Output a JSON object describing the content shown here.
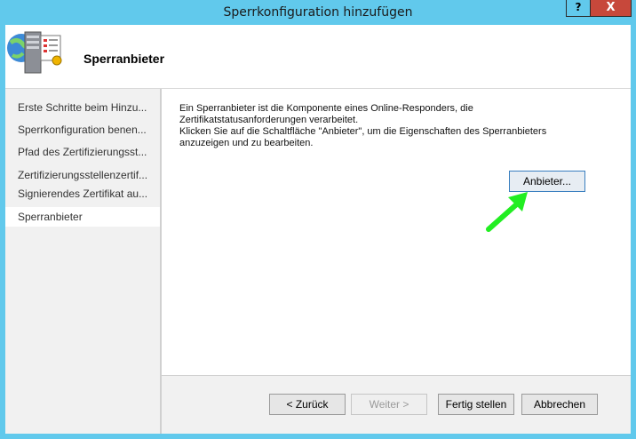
{
  "window": {
    "title": "Sperrkonfiguration hinzufügen",
    "help_label": "?",
    "close_label": "X"
  },
  "header": {
    "title": "Sperranbieter",
    "icon": "server-certificate-icon"
  },
  "sidebar": {
    "items": [
      {
        "label": "Erste Schritte beim Hinzu...",
        "active": false
      },
      {
        "label": "Sperrkonfiguration benen...",
        "active": false
      },
      {
        "label": "Pfad des Zertifizierungsst...",
        "active": false
      },
      {
        "label": "Zertifizierungsstellenzertif...",
        "active": false
      },
      {
        "label": "Signierendes Zertifikat au...",
        "active": false
      },
      {
        "label": "Sperranbieter",
        "active": true
      }
    ]
  },
  "main": {
    "description_lines": [
      "Ein Sperranbieter ist die Komponente eines Online-Responders, die",
      "Zertifikatstatusanforderungen verarbeitet.",
      "Klicken Sie auf die Schaltfläche \"Anbieter\", um die Eigenschaften des Sperranbieters",
      "anzuzeigen und zu bearbeiten."
    ],
    "provider_button": "Anbieter..."
  },
  "footer": {
    "back": "< Zurück",
    "next": "Weiter >",
    "finish": "Fertig stellen",
    "cancel": "Abbrechen"
  },
  "colors": {
    "titlebar": "#61c9ec",
    "close": "#c7483b",
    "arrow": "#22ee22",
    "focus_border": "#3a7fc0"
  }
}
